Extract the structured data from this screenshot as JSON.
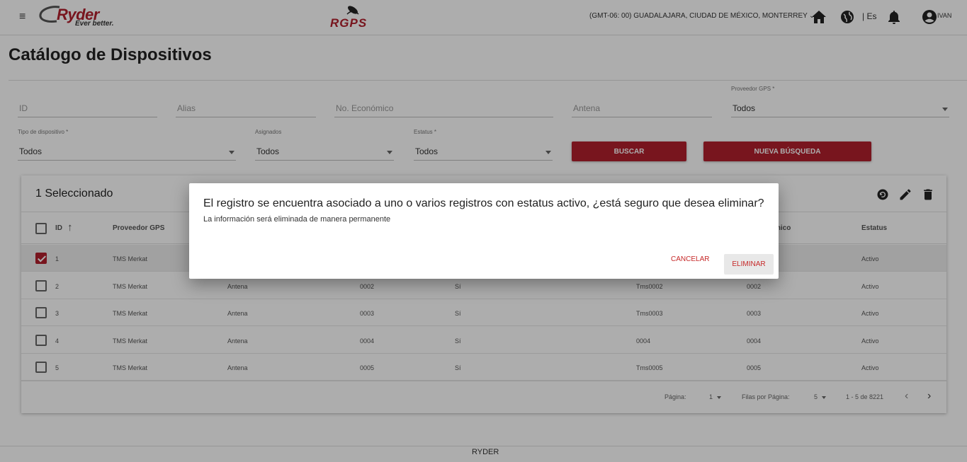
{
  "header": {
    "menu_icon": "hamburger-icon",
    "logo_text": "Ryder",
    "logo_tagline": "Ever better.",
    "app_logo_text": "RGPS",
    "timezone": "(GMT-06: 00) GUADALAJARA, CIUDAD DE MÉXICO, MONTERREY",
    "language": "| Es",
    "user": "IVAN",
    "icons": [
      "home-icon",
      "globe-icon",
      "bell-icon",
      "account-circle-icon"
    ]
  },
  "page": {
    "title": "Catálogo de Dispositivos"
  },
  "filters": {
    "id_placeholder": "ID",
    "alias_placeholder": "Alias",
    "economico_placeholder": "No. Económico",
    "antena_placeholder": "Antena",
    "proveedor_label": "Proveedor GPS *",
    "proveedor_value": "Todos",
    "tipo_label": "Tipo de dispositivo *",
    "tipo_value": "Todos",
    "asignados_label": "Asignados",
    "asignados_value": "Todos",
    "estatus_label": "Estatus *",
    "estatus_value": "Todos",
    "buscar_label": "BUSCAR",
    "nueva_label": "NUEVA BÚSQUEDA"
  },
  "table": {
    "selected_text": "1 Seleccionado",
    "tool_icons": [
      "restore-icon",
      "edit-icon",
      "delete-icon"
    ],
    "headers": {
      "id": "ID",
      "proveedor": "Proveedor GPS",
      "economico": "mico",
      "estatus": "Estatus"
    },
    "rows": [
      {
        "checked": true,
        "id": "1",
        "proveedor": "TMS Merkat",
        "tipo": "",
        "clave": "",
        "asignado": "",
        "alias": "",
        "economico": "",
        "estatus": "Activo"
      },
      {
        "checked": false,
        "id": "2",
        "proveedor": "TMS Merkat",
        "tipo": "Antena",
        "clave": "0002",
        "asignado": "Sí",
        "alias": "Tms0002",
        "economico": "0002",
        "estatus": "Activo"
      },
      {
        "checked": false,
        "id": "3",
        "proveedor": "TMS Merkat",
        "tipo": "Antena",
        "clave": "0003",
        "asignado": "Sí",
        "alias": "Tms0003",
        "economico": "0003",
        "estatus": "Activo"
      },
      {
        "checked": false,
        "id": "4",
        "proveedor": "TMS Merkat",
        "tipo": "Antena",
        "clave": "0004",
        "asignado": "Sí",
        "alias": "0004",
        "economico": "0004",
        "estatus": "Activo"
      },
      {
        "checked": false,
        "id": "5",
        "proveedor": "TMS Merkat",
        "tipo": "Antena",
        "clave": "0005",
        "asignado": "Sí",
        "alias": "Tms0005",
        "economico": "0005",
        "estatus": "Activo"
      }
    ],
    "pager": {
      "page_label": "Página:",
      "page_value": "1",
      "rows_label": "Filas por Página:",
      "rows_value": "5",
      "range": "1 - 5 de 8221"
    }
  },
  "dialog": {
    "title": "El registro se encuentra asociado a uno o varios registros con estatus activo, ¿está seguro que desea eliminar?",
    "message": "La información será eliminada de manera permanente",
    "cancel_label": "CANCELAR",
    "confirm_label": "ELIMINAR"
  },
  "footer": {
    "text": "RYDER"
  },
  "colors": {
    "brand": "#b11f2d",
    "dialog_action": "#c62828"
  }
}
